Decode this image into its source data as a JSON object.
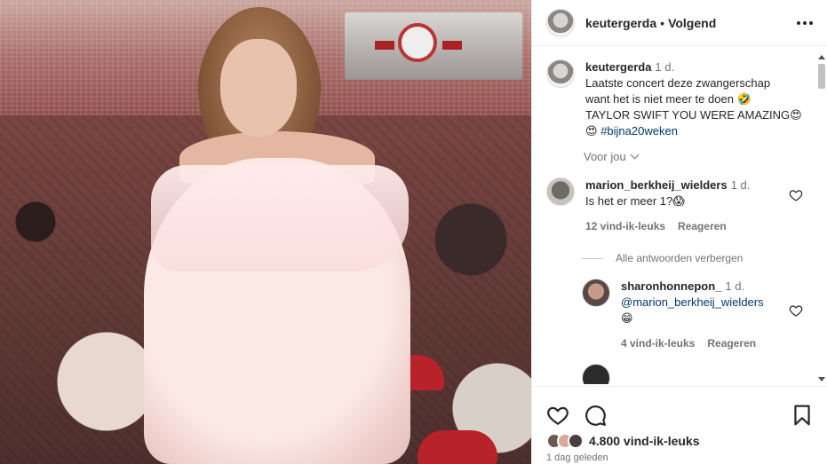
{
  "post": {
    "author": {
      "username": "keutergerda",
      "follow_state": "Volgend",
      "separator": "•"
    },
    "caption": {
      "username": "keutergerda",
      "time": "1 d.",
      "lines": [
        "Laatste concert deze zwangerschap",
        "want het is niet meer te doen 🤣",
        "TAYLOR SWIFT YOU WERE AMAZING😍"
      ],
      "last_line_emoji": "😍",
      "hashtag": "#bijna20weken",
      "see_more": "Voor jou"
    },
    "comments": [
      {
        "username": "marion_berkheij_wielders",
        "time": "1 d.",
        "text": "Is het er meer 1?😱",
        "likes": "12 vind-ik-leuks",
        "reply_label": "Reageren",
        "hide_replies": "Alle antwoorden verbergen",
        "replies": [
          {
            "username": "sharonhonnepon_",
            "time": "1 d.",
            "mention": "@marion_berkheij_wielders",
            "text": "😁",
            "likes": "4 vind-ik-leuks",
            "reply_label": "Reageren"
          }
        ]
      }
    ],
    "footer": {
      "likes": "4.800 vind-ik-leuks",
      "date": "1 dag geleden"
    },
    "icons": {
      "more": "more-options-icon",
      "heart": "heart-icon",
      "comment": "comment-icon",
      "save": "bookmark-icon"
    }
  }
}
